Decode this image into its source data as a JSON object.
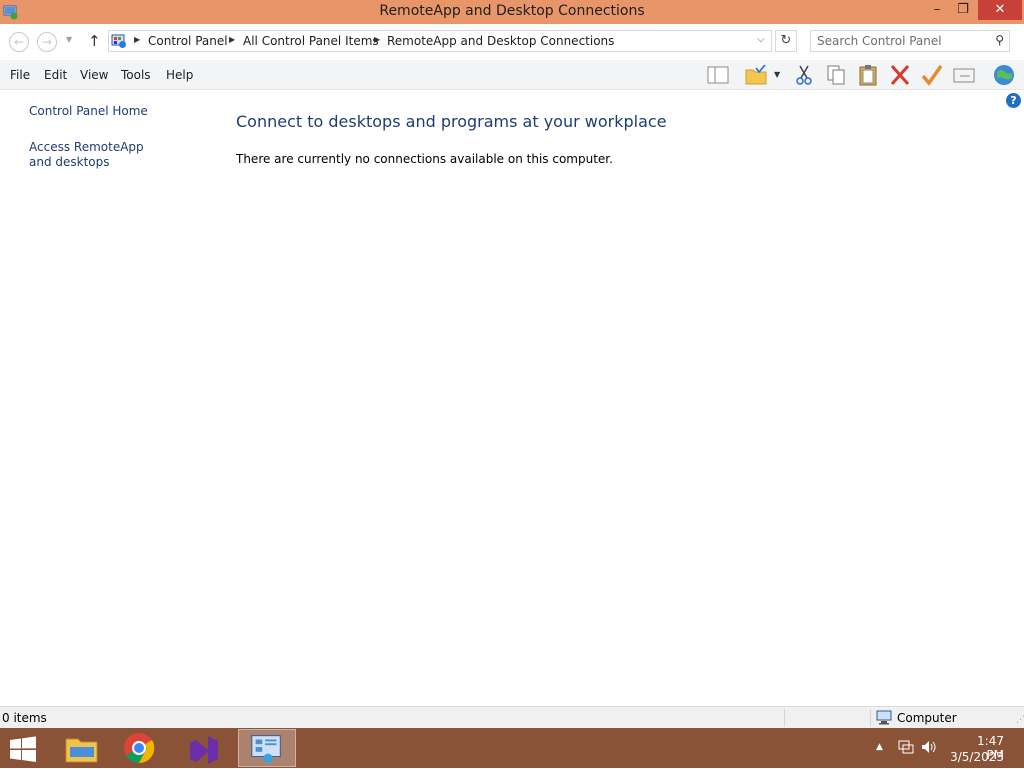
{
  "window": {
    "title": "RemoteApp and Desktop Connections",
    "buttons": {
      "minimize": "–",
      "maximize": "❐",
      "close": "✕"
    }
  },
  "nav": {
    "back_glyph": "←",
    "forward_glyph": "→",
    "recent_glyph": "▼",
    "up_glyph": "↑",
    "breadcrumb": [
      "Control Panel",
      "All Control Panel Items",
      "RemoteApp and Desktop Connections"
    ],
    "breadcrumb_separator": "▶",
    "dropdown_glyph": "⌵",
    "refresh_glyph": "↻",
    "search_placeholder": "Search Control Panel",
    "search_glyph": "⚲"
  },
  "menu": {
    "items": [
      "File",
      "Edit",
      "View",
      "Tools",
      "Help"
    ]
  },
  "toolbar": {
    "icons": [
      "layout-pane-icon",
      "folder-check-icon",
      "cut-icon",
      "copy-icon",
      "paste-icon",
      "delete-icon",
      "checkmark-icon",
      "properties-icon",
      "globe-icon"
    ],
    "help_glyph": "?"
  },
  "sidebar": {
    "links": [
      "Control Panel Home",
      "Access RemoteApp and desktops"
    ]
  },
  "main": {
    "heading": "Connect to desktops and programs at your workplace",
    "message": "There are currently no connections available on this computer."
  },
  "statusbar": {
    "items_count": "0 items",
    "location": "Computer"
  },
  "taskbar": {
    "apps": [
      "start-button",
      "file-explorer",
      "chrome",
      "visual-studio",
      "control-panel"
    ],
    "tray_arrow": "▲",
    "time": "1:47 PM",
    "date": "3/5/2023"
  },
  "colors": {
    "titlebar": "#e8956a",
    "close_button": "#c7403a",
    "link": "#1e3d73",
    "taskbar": "#8a5337"
  }
}
